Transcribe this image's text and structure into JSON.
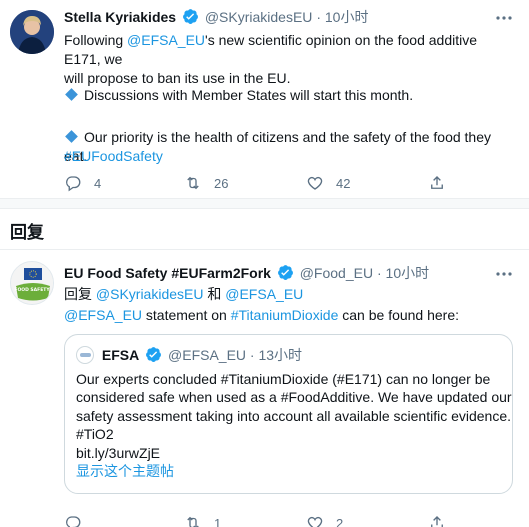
{
  "tweet1": {
    "name": "Stella Kyriakides",
    "handle": "@SKyriakidesEU",
    "separator": "·",
    "time": "10小时",
    "line1_prefix": "Following ",
    "line1_mention": "@EFSA_EU",
    "line1_suffix": "'s new scientific opinion on the food additive E171, we",
    "line2": "will propose to ban its use in the EU.",
    "bullet1": "Discussions with Member States will start this month.",
    "bullet2": "Our priority is the health of citizens and the safety of the food they eat.",
    "hashtag": "#EUFoodSafety",
    "replies": "4",
    "retweets": "26",
    "likes": "42"
  },
  "section": {
    "label": "回复"
  },
  "tweet2": {
    "name": "EU Food Safety #EUFarm2Fork",
    "handle": "@Food_EU",
    "separator": "·",
    "time": "10小时",
    "reply_prefix": "回复 ",
    "reply_user1": "@SKyriakidesEU",
    "reply_and": " 和 ",
    "reply_user2": "@EFSA_EU",
    "text_mention": "@EFSA_EU",
    "text_middle": " statement on ",
    "text_hashtag": "#TitaniumDioxide",
    "text_suffix": " can be found here:",
    "replies": "",
    "retweets": "1",
    "likes": "2",
    "avatar_text": "FOOD SAFETY"
  },
  "quote": {
    "name": "EFSA",
    "handle": "@EFSA_EU",
    "separator": "·",
    "time": "13小时",
    "line1": "Our experts concluded #TitaniumDioxide (#E171) can no longer be",
    "line2": "considered safe when used as a #FoodAdditive. We have updated our",
    "line3": "safety assessment taking into account all available scientific evidence.",
    "line4": "#TiO2",
    "line5": "bit.ly/3urwZjE",
    "show_thread": "显示这个主题帖"
  },
  "colors": {
    "accent": "#1b95e0",
    "muted": "#5b7083",
    "text": "#0f1419"
  },
  "icons": [
    "verified-badge-icon",
    "more-icon",
    "reply-icon",
    "retweet-icon",
    "like-icon",
    "share-icon"
  ]
}
